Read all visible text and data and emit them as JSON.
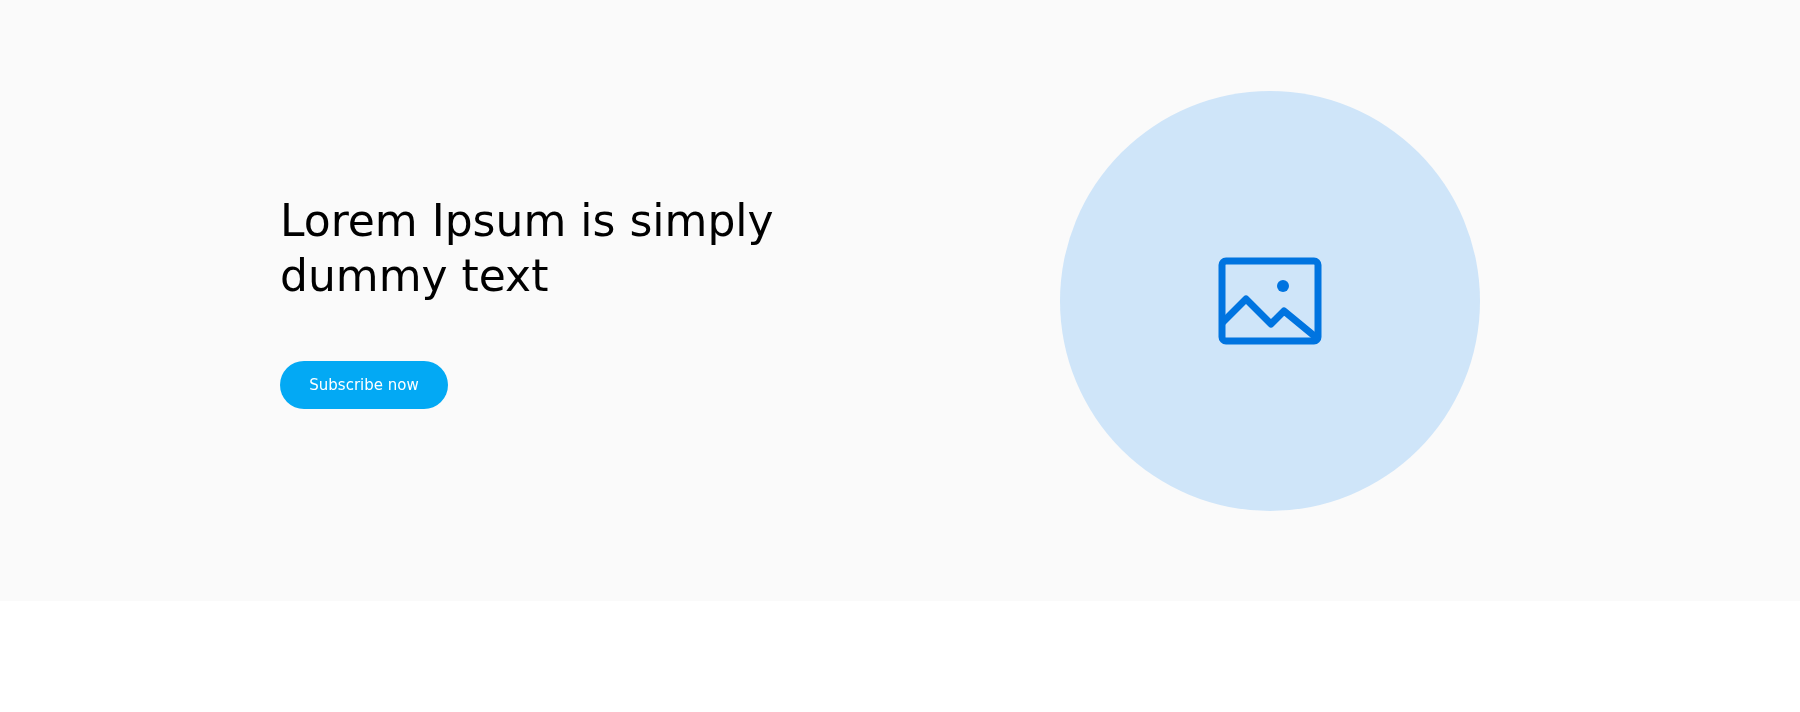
{
  "hero": {
    "heading": "Lorem Ipsum is simply dummy text",
    "button": {
      "label": "Subscribe now"
    }
  }
}
